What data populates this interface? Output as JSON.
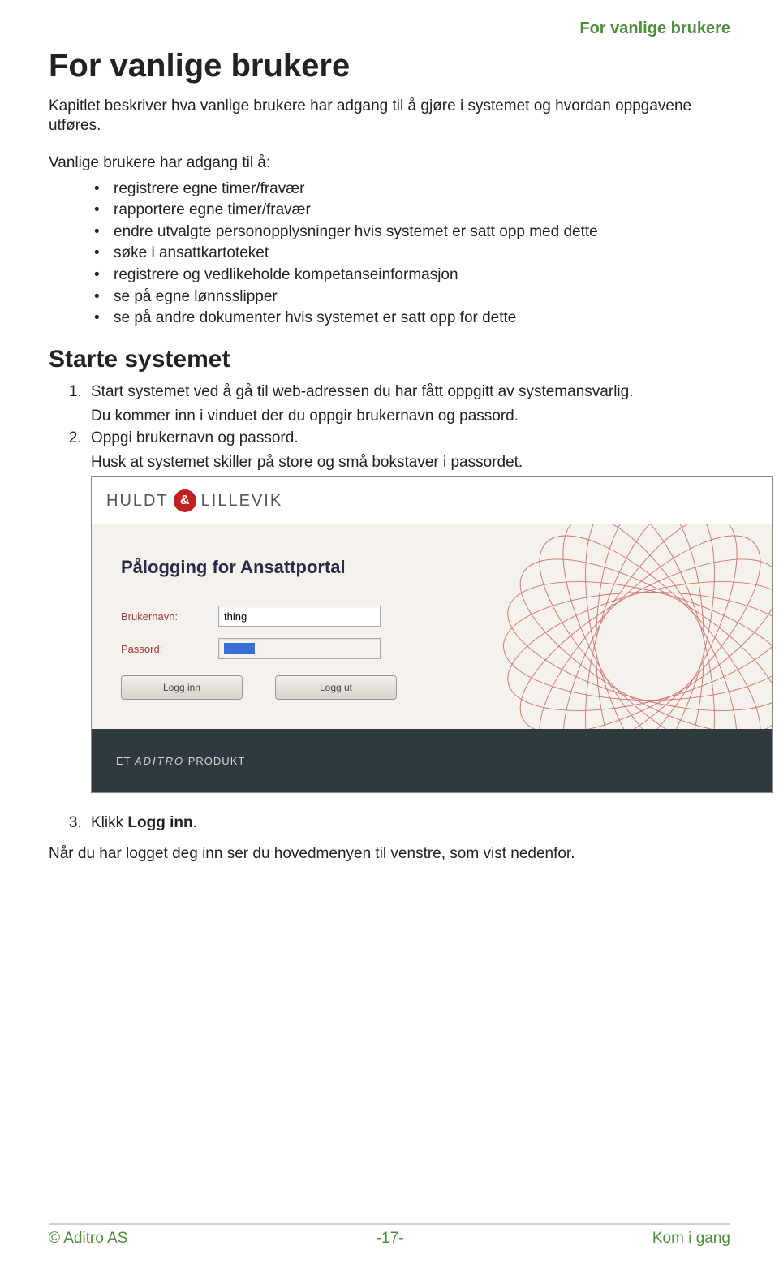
{
  "header": {
    "running": "For vanlige brukere"
  },
  "title": "For vanlige brukere",
  "intro": "Kapitlet beskriver hva vanlige brukere har adgang til å gjøre i systemet og hvordan oppgavene utføres.",
  "lead_in": "Vanlige brukere har adgang til å:",
  "bullets": [
    "registrere egne timer/fravær",
    "rapportere egne timer/fravær",
    "endre utvalgte personopplysninger hvis systemet er satt opp med dette",
    "søke i ansattkartoteket",
    "registrere og vedlikeholde kompetanseinformasjon",
    "se på egne lønnsslipper",
    "se på andre dokumenter hvis systemet er satt opp for dette"
  ],
  "subtitle": "Starte systemet",
  "steps": {
    "s1": "Start systemet ved å gå til web-adressen du har fått oppgitt av systemansvarlig.",
    "s1b": "Du kommer inn i vinduet der du oppgir brukernavn og passord.",
    "s2": "Oppgi brukernavn og passord.",
    "s2b": "Husk at systemet skiller på store og små bokstaver i passordet.",
    "s3_pre": "Klikk ",
    "s3_bold": "Logg inn",
    "s3_post": "."
  },
  "login": {
    "brand_left": "HULDT",
    "brand_right": "LILLEVIK",
    "heading": "Pålogging for Ansattportal",
    "user_label": "Brukernavn:",
    "user_value": "thing",
    "pass_label": "Passord:",
    "pass_value": "••••",
    "btn_login": "Logg inn",
    "btn_logout": "Logg ut",
    "foot_pre": "ET ",
    "foot_brand": "ADITRO",
    "foot_post": " PRODUKT"
  },
  "final": "Når du har logget deg inn ser du hovedmenyen til venstre, som vist nedenfor.",
  "footer": {
    "left": "© Aditro AS",
    "mid": "-17-",
    "right": "Kom i gang"
  }
}
